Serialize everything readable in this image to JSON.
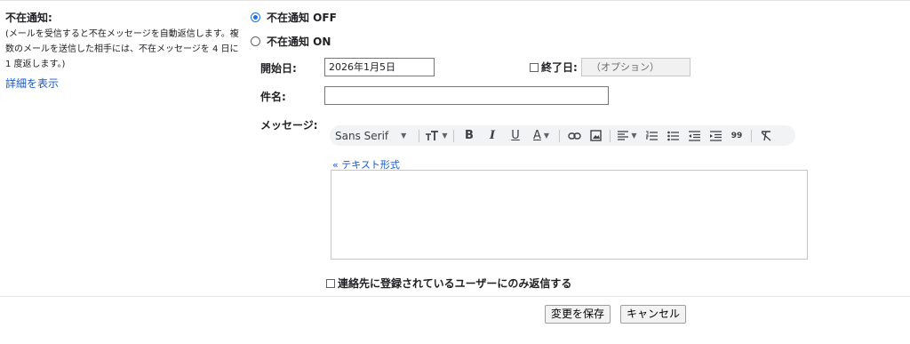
{
  "vacation": {
    "section_title": "不在通知:",
    "description": "(メールを受信すると不在メッセージを自動返信します。複数のメールを送信した相手には、不在メッセージを 4 日に 1 度返します。)",
    "details_link": "詳細を表示",
    "options": [
      {
        "label": "不在通知 OFF",
        "selected": true
      },
      {
        "label": "不在通知 ON",
        "selected": false
      }
    ],
    "start_date_label": "開始日:",
    "start_date_value": "2026年1月5日",
    "end_date_label": "終了日:",
    "end_date_checked": false,
    "end_date_placeholder": "（オプション）",
    "subject_label": "件名:",
    "subject_value": "",
    "message_label": "メッセージ:",
    "toolbar": {
      "font_name": "Sans Serif",
      "buttons": [
        "size-icon",
        "bold-icon",
        "italic-icon",
        "underline-icon",
        "text-color-icon",
        "link-icon",
        "image-icon",
        "align-icon",
        "numbered-list-icon",
        "bulleted-list-icon",
        "indent-less-icon",
        "indent-more-icon",
        "quote-icon",
        "remove-formatting-icon"
      ],
      "bold": "B",
      "italic": "I",
      "underline": "U",
      "text_color": "A",
      "quote": "99"
    },
    "plain_text_link": "« テキスト形式",
    "contacts_only_label": "連絡先に登録されているユーザーにのみ返信する",
    "contacts_only_checked": false,
    "save_button": "変更を保存",
    "cancel_button": "キャンセル",
    "colors": {
      "link": "#1a57c9",
      "radio_accent": "#1a73e8",
      "toolbar_bg": "#f1f3f4"
    }
  }
}
